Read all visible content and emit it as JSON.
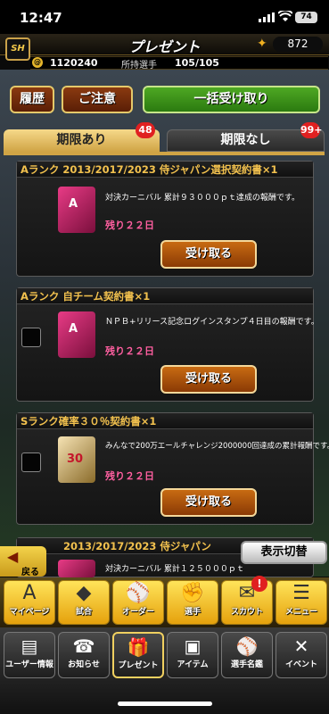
{
  "status": {
    "time": "12:47",
    "battery": "74"
  },
  "header": {
    "title": "プレゼント",
    "coins": "872"
  },
  "money_bar": {
    "money": "1120240",
    "players_label": "所持選手",
    "players_value": "105/105"
  },
  "actions": {
    "history": "履歴",
    "caution": "ご注意",
    "receive_all": "一括受け取り"
  },
  "tabs": [
    {
      "label": "期限あり",
      "badge": "48"
    },
    {
      "label": "期限なし",
      "badge": "99+"
    }
  ],
  "items": [
    {
      "title": "Aランク 2013/2017/2023 侍ジャパン選択契約書×1",
      "desc": "対決カーニバル 累計９３０００ｐｔ達成の報酬です。",
      "remaining": "残り２２日",
      "button": "受け取る",
      "thumb_letter": "A"
    },
    {
      "title": "Aランク 自チーム契約書×1",
      "desc": "ＮＰＢ+リリース記念ログインスタンプ４日目の報酬です。",
      "remaining": "残り２２日",
      "button": "受け取る",
      "thumb_letter": "A"
    },
    {
      "title": "Sランク確率３０％契約書×1",
      "desc": "みんなで200万エールチャレンジ2000000回達成の累計報酬です。",
      "remaining": "残り２２日",
      "button": "受け取る",
      "thumb_letter": "30"
    },
    {
      "title": "2013/2017/2023 侍ジャパン",
      "desc": "対決カーニバル 累計１２５０００ｐｔ"
    }
  ],
  "bottom": {
    "back": "戻る",
    "switch": "表示切替"
  },
  "nav_primary": [
    {
      "label": "マイページ",
      "icon": "A"
    },
    {
      "label": "試合",
      "icon": "◆"
    },
    {
      "label": "オーダー",
      "icon": "⚾"
    },
    {
      "label": "選手",
      "icon": "✊"
    },
    {
      "label": "スカウト",
      "icon": "✉"
    },
    {
      "label": "メニュー",
      "icon": "☰"
    }
  ],
  "nav_secondary": [
    {
      "label": "ユーザー情報",
      "icon": "▤"
    },
    {
      "label": "お知らせ",
      "icon": "☎"
    },
    {
      "label": "プレゼント",
      "icon": "🎁"
    },
    {
      "label": "アイテム",
      "icon": "▣"
    },
    {
      "label": "選手名鑑",
      "icon": "⚾"
    },
    {
      "label": "イベント",
      "icon": "✕"
    }
  ],
  "colors": {
    "accent": "#d0a445",
    "green": "#4ea823",
    "remaining": "#ff5fa0"
  }
}
